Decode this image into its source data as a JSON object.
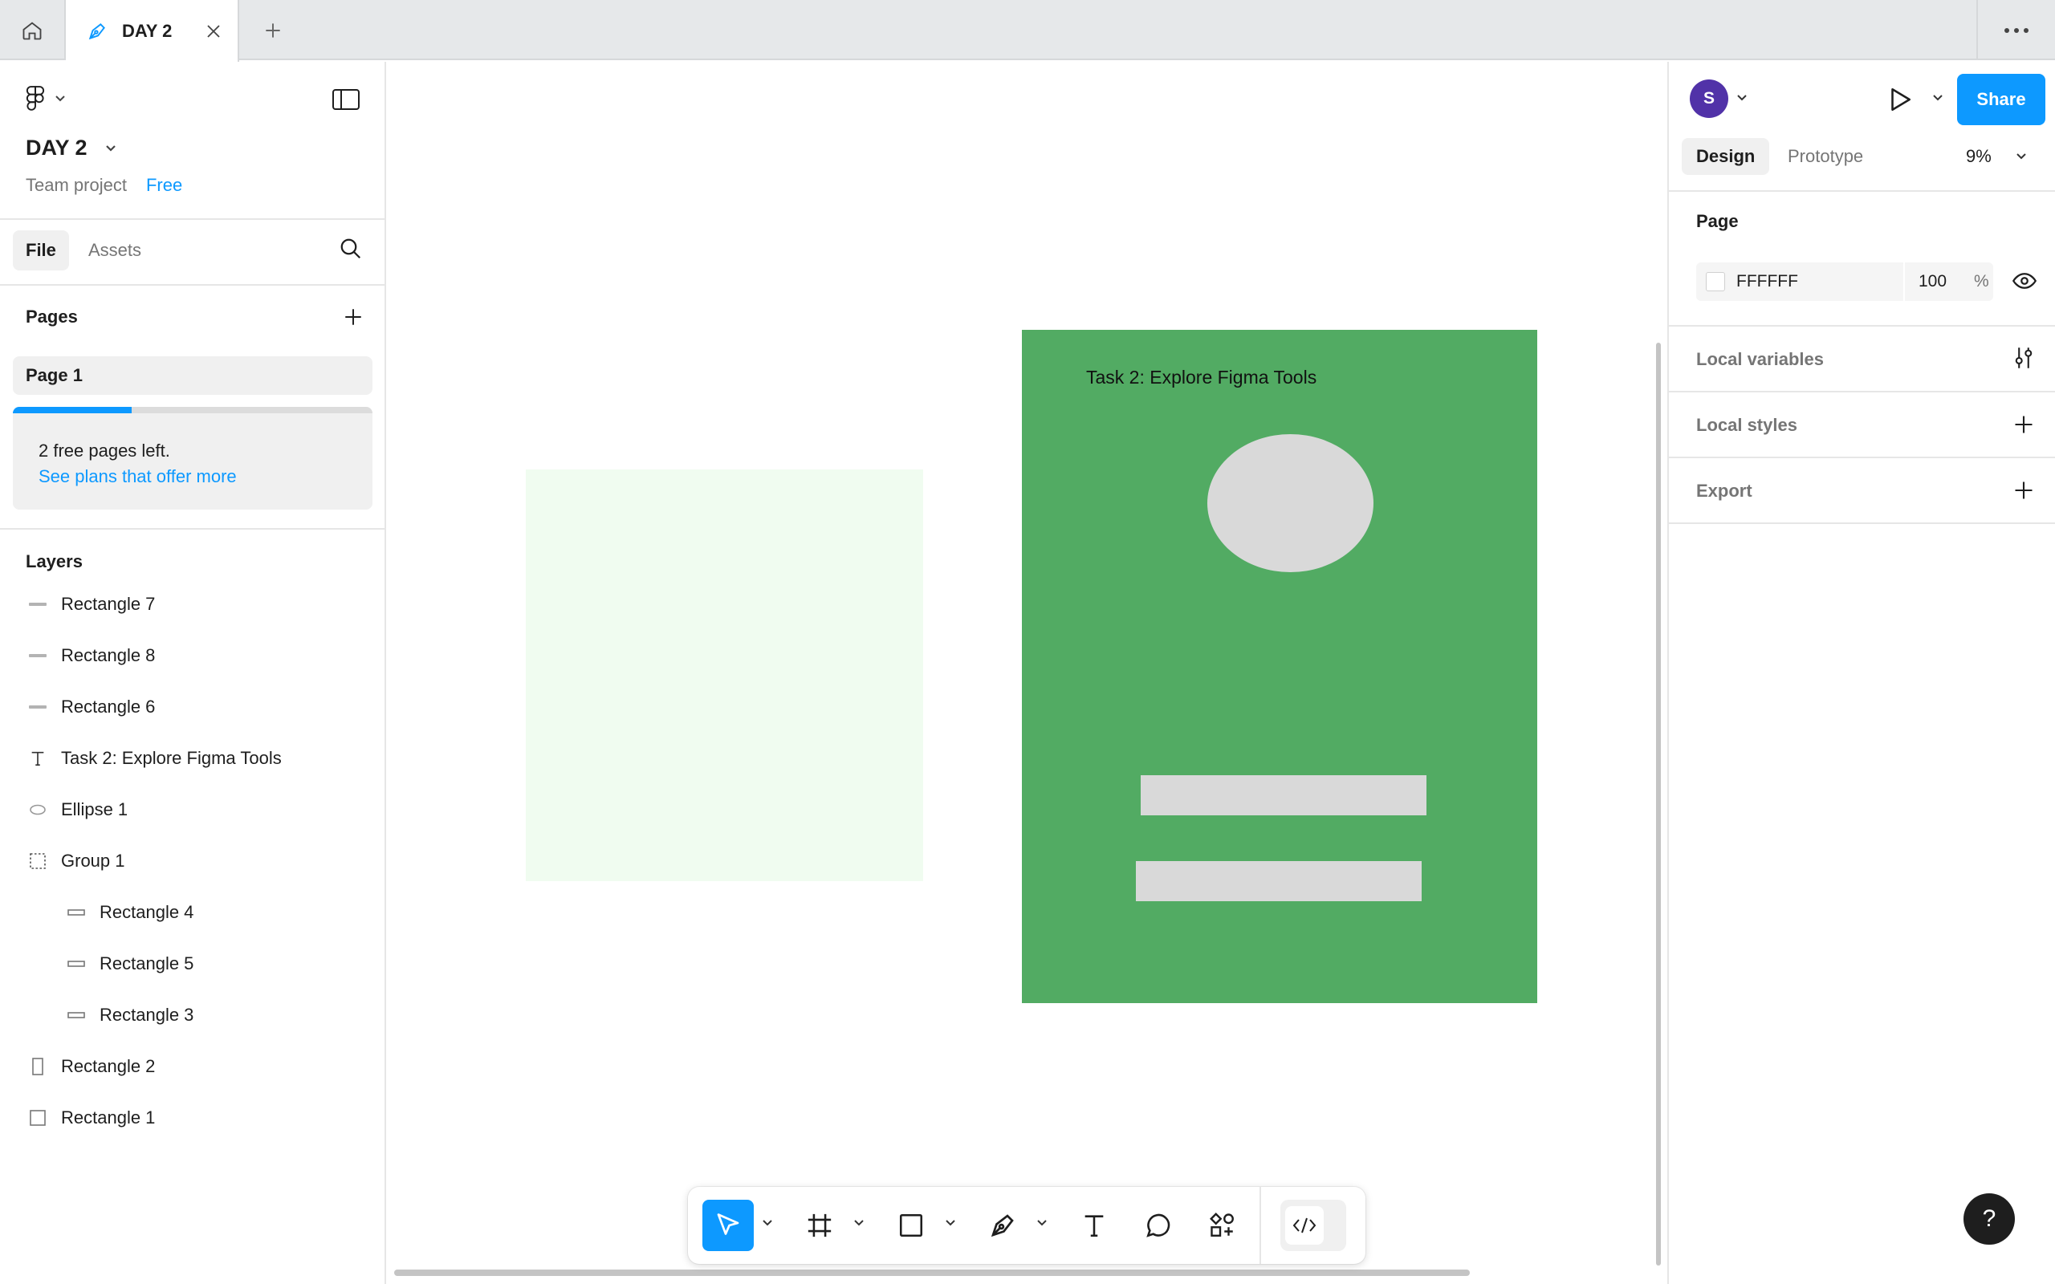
{
  "tabs": {
    "document_tab": "DAY 2"
  },
  "file": {
    "title": "DAY 2",
    "team": "Team project",
    "plan": "Free"
  },
  "left_tabs": {
    "file": "File",
    "assets": "Assets"
  },
  "pages": {
    "header": "Pages",
    "items": [
      "Page 1"
    ],
    "promo_text": "2 free pages left.",
    "promo_link": "See plans that offer more",
    "promo_progress": 0.33
  },
  "layers": {
    "header": "Layers",
    "items": [
      {
        "label": "Rectangle 7",
        "icon": "line-icon",
        "indent": 0
      },
      {
        "label": "Rectangle 8",
        "icon": "line-icon",
        "indent": 0
      },
      {
        "label": "Rectangle 6",
        "icon": "line-icon",
        "indent": 0
      },
      {
        "label": "Task 2: Explore Figma Tools",
        "icon": "text-icon",
        "indent": 0
      },
      {
        "label": "Ellipse 1",
        "icon": "ellipse-icon",
        "indent": 0
      },
      {
        "label": "Group 1",
        "icon": "group-icon",
        "indent": 0
      },
      {
        "label": "Rectangle 4",
        "icon": "flat-rect-icon",
        "indent": 1
      },
      {
        "label": "Rectangle 5",
        "icon": "flat-rect-icon",
        "indent": 1
      },
      {
        "label": "Rectangle 3",
        "icon": "flat-rect-icon",
        "indent": 1
      },
      {
        "label": "Rectangle 2",
        "icon": "tall-rect-icon",
        "indent": 0
      },
      {
        "label": "Rectangle 1",
        "icon": "square-icon",
        "indent": 0
      }
    ]
  },
  "canvas": {
    "frame_text": "Task 2: Explore Figma Tools",
    "frame_color": "#52ab63",
    "light_rect_color": "#f0fcf0",
    "placeholder_color": "#d9d9d9"
  },
  "right": {
    "avatar_initial": "S",
    "share": "Share",
    "design_tab": "Design",
    "prototype_tab": "Prototype",
    "zoom": "9%",
    "page_section": "Page",
    "bg_hex": "FFFFFF",
    "bg_opacity": "100",
    "bg_pct": "%",
    "local_variables": "Local variables",
    "local_styles": "Local styles",
    "export": "Export"
  },
  "help": "?",
  "colors": {
    "accent": "#0d99ff",
    "avatar": "#5132a8"
  }
}
